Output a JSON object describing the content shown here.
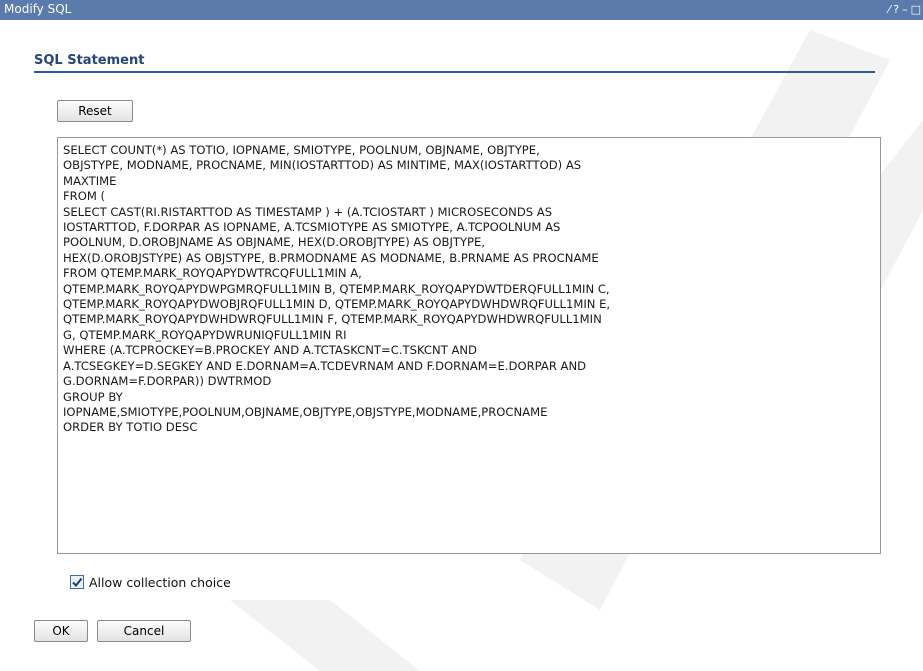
{
  "window": {
    "title": "Modify SQL",
    "controls": [
      "⁄",
      "?",
      "–",
      "□"
    ]
  },
  "section": {
    "heading": "SQL Statement"
  },
  "buttons": {
    "reset": "Reset",
    "ok": "OK",
    "cancel": "Cancel"
  },
  "sql": {
    "text": "SELECT COUNT(*) AS TOTIO, IOPNAME, SMIOTYPE, POOLNUM, OBJNAME, OBJTYPE,\nOBJSTYPE, MODNAME, PROCNAME, MIN(IOSTARTTOD) AS MINTIME, MAX(IOSTARTTOD) AS\nMAXTIME\nFROM (\nSELECT CAST(RI.RISTARTTOD AS TIMESTAMP ) + (A.TCIOSTART ) MICROSECONDS AS\nIOSTARTTOD, F.DORPAR AS IOPNAME, A.TCSMIOTYPE AS SMIOTYPE, A.TCPOOLNUM AS\nPOOLNUM, D.OROBJNAME AS OBJNAME, HEX(D.OROBJTYPE) AS OBJTYPE,\nHEX(D.OROBJSTYPE) AS OBJSTYPE, B.PRMODNAME AS MODNAME, B.PRNAME AS PROCNAME\nFROM QTEMP.MARK_ROYQAPYDWTRCQFULL1MIN A,\nQTEMP.MARK_ROYQAPYDWPGMRQFULL1MIN B, QTEMP.MARK_ROYQAPYDWTDERQFULL1MIN C,\nQTEMP.MARK_ROYQAPYDWOBJRQFULL1MIN D, QTEMP.MARK_ROYQAPYDWHDWRQFULL1MIN E,\nQTEMP.MARK_ROYQAPYDWHDWRQFULL1MIN F, QTEMP.MARK_ROYQAPYDWHDWRQFULL1MIN\nG, QTEMP.MARK_ROYQAPYDWRUNIQFULL1MIN RI\nWHERE (A.TCPROCKEY=B.PROCKEY AND A.TCTASKCNT=C.TSKCNT AND\nA.TCSEGKEY=D.SEGKEY AND E.DORNAM=A.TCDEVRNAM AND F.DORNAM=E.DORPAR AND\nG.DORNAM=F.DORPAR)) DWTRMOD\nGROUP BY\nIOPNAME,SMIOTYPE,POOLNUM,OBJNAME,OBJTYPE,OBJSTYPE,MODNAME,PROCNAME\nORDER BY TOTIO DESC"
  },
  "options": {
    "allow_collection_label": "Allow collection choice",
    "allow_collection_checked": true
  },
  "colors": {
    "titlebar": "#5c7bad",
    "heading": "#26457a",
    "rule": "#2a5aa3",
    "watermark": "#f2f2f2"
  }
}
